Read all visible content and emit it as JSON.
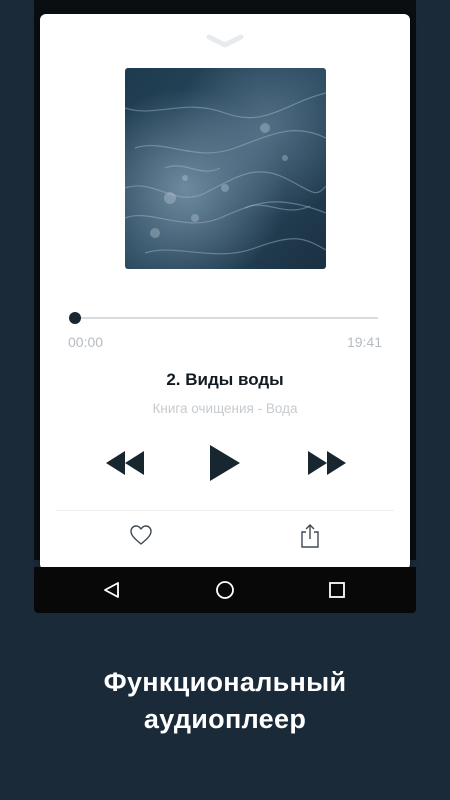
{
  "player": {
    "progress_fraction": 0.01,
    "time_elapsed": "00:00",
    "time_total": "19:41",
    "track_title": "2. Виды воды",
    "track_subtitle": "Книга очищения - Вода"
  },
  "icons": {
    "collapse": "chevron-down-icon",
    "rewind": "rewind-icon",
    "play": "play-icon",
    "fast_forward": "fast-forward-icon",
    "like": "heart-icon",
    "share": "share-icon",
    "nav_back": "back-triangle-icon",
    "nav_home": "home-circle-icon",
    "nav_recents": "recents-square-icon"
  },
  "colors": {
    "background": "#1a2a38",
    "card": "#ffffff",
    "accent": "#17262f"
  },
  "caption": {
    "line1": "Функциональный",
    "line2": "аудиоплеер"
  }
}
